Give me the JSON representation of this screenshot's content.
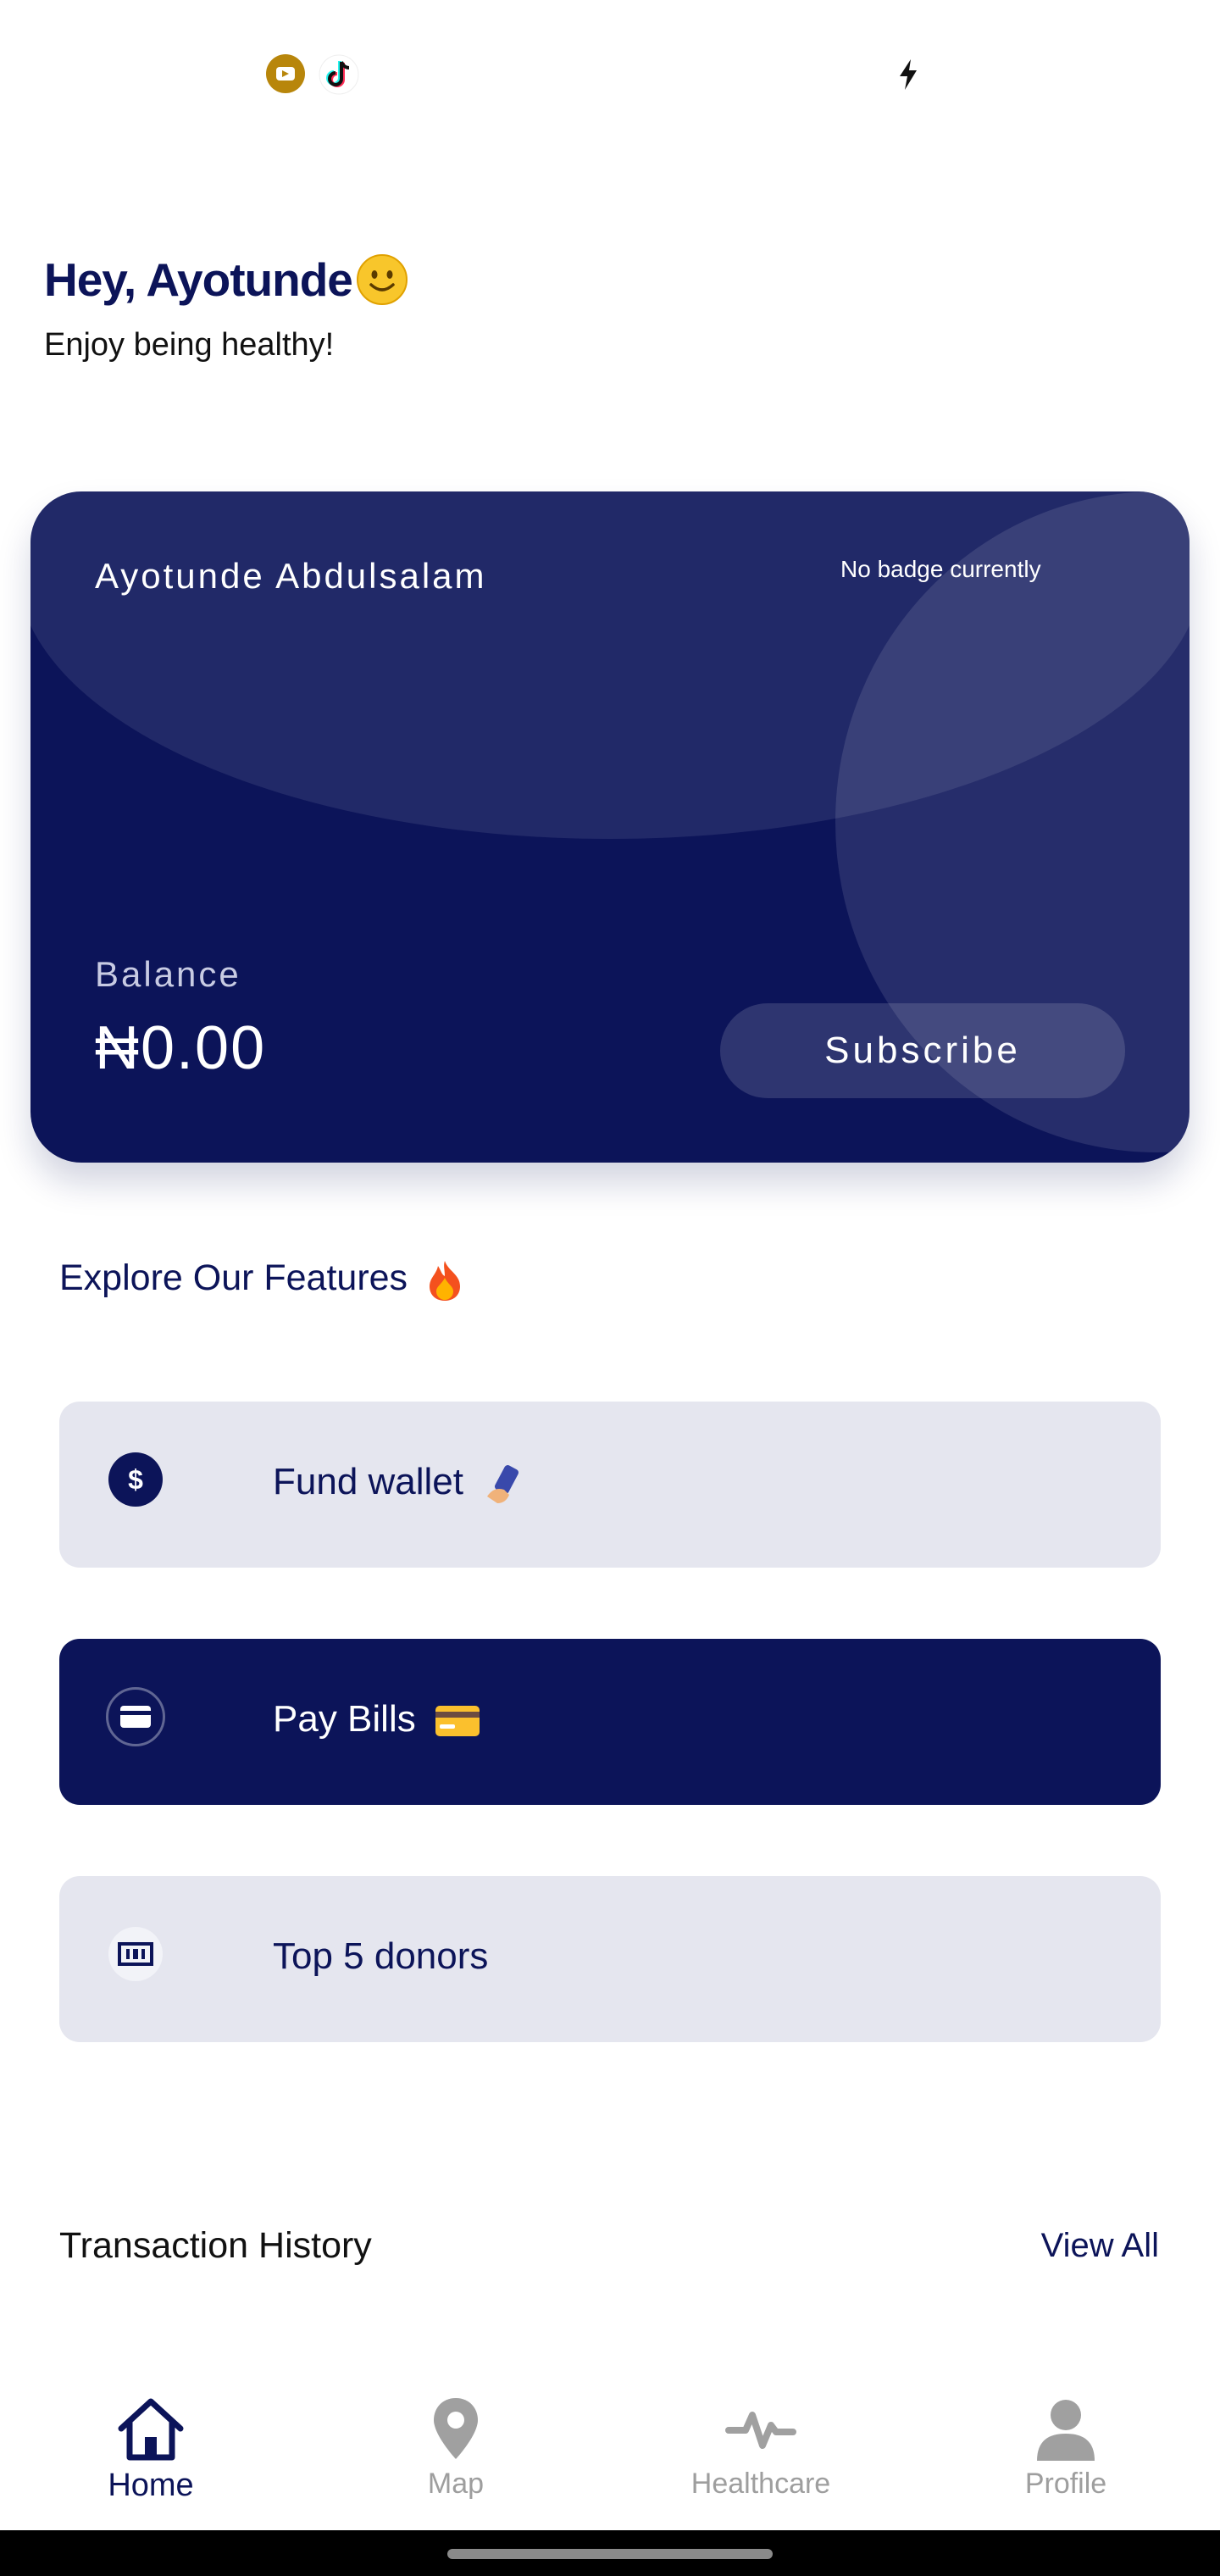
{
  "greeting": {
    "title": "Hey, Ayotunde",
    "subtitle": "Enjoy being healthy!"
  },
  "card": {
    "holder_name": "Ayotunde Abdulsalam",
    "badge_text": "No badge currently",
    "balance_label": "Balance",
    "balance_value": "₦0.00",
    "subscribe_label": "Subscribe"
  },
  "features": {
    "title": "Explore Our Features",
    "items": [
      {
        "label": "Fund wallet",
        "icon": "dollar-circle-icon",
        "style": "light"
      },
      {
        "label": "Pay Bills",
        "icon": "credit-card-icon",
        "style": "dark"
      },
      {
        "label": "Top 5 donors",
        "icon": "bank-note-icon",
        "style": "light"
      }
    ]
  },
  "transactions": {
    "title": "Transaction History",
    "view_all_label": "View All"
  },
  "bottom_nav": {
    "items": [
      {
        "label": "Home",
        "icon": "home-icon",
        "active": true
      },
      {
        "label": "Map",
        "icon": "map-pin-icon",
        "active": false
      },
      {
        "label": "Healthcare",
        "icon": "pulse-icon",
        "active": false
      },
      {
        "label": "Profile",
        "icon": "person-icon",
        "active": false
      }
    ]
  },
  "colors": {
    "primary": "#0c1459",
    "feature_light_bg": "#e5e6ef",
    "inactive_nav": "#9e9e9e"
  }
}
